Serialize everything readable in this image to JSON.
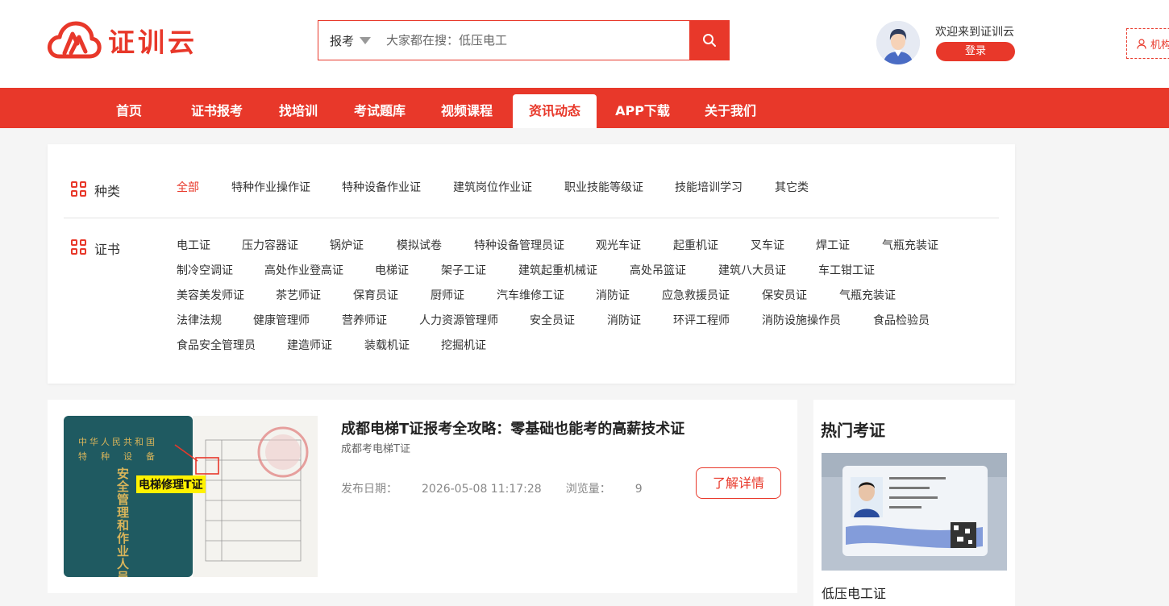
{
  "brand": {
    "name": "证训云",
    "accent": "#e8382a"
  },
  "search": {
    "category": "报考",
    "placeholder": "大家都在搜：低压电工"
  },
  "user": {
    "welcome": "欢迎来到证训云",
    "login_label": "登录",
    "org_label": "机构"
  },
  "nav": {
    "items": [
      {
        "label": "首页"
      },
      {
        "label": "证书报考"
      },
      {
        "label": "找培训"
      },
      {
        "label": "考试题库"
      },
      {
        "label": "视频课程"
      },
      {
        "label": "资讯动态"
      },
      {
        "label": "APP下载"
      },
      {
        "label": "关于我们"
      }
    ],
    "active": "资讯动态"
  },
  "filter": {
    "category_title": "种类",
    "categories": [
      "全部",
      "特种作业操作证",
      "特种设备作业证",
      "建筑岗位作业证",
      "职业技能等级证",
      "技能培训学习",
      "其它类"
    ],
    "active_category": "全部",
    "cert_title": "证书",
    "certificates": [
      [
        "电工证",
        "压力容器证",
        "锅炉证",
        "模拟试卷",
        "特种设备管理员证",
        "观光车证",
        "起重机证",
        "叉车证",
        "焊工证",
        "气瓶充装证"
      ],
      [
        "制冷空调证",
        "高处作业登高证",
        "电梯证",
        "架子工证",
        "建筑起重机械证",
        "高处吊篮证",
        "建筑八大员证",
        "车工钳工证"
      ],
      [
        "美容美发师证",
        "茶艺师证",
        "保育员证",
        "厨师证",
        "汽车维修工证",
        "消防证",
        "应急救援员证",
        "保安员证",
        "气瓶充装证"
      ],
      [
        "法律法规",
        "健康管理师",
        "营养师证",
        "人力资源管理师",
        "安全员证",
        "消防证",
        "环评工程师",
        "消防设施操作员",
        "食品检验员"
      ],
      [
        "食品安全管理员",
        "建造师证",
        "装载机证",
        "挖掘机证"
      ]
    ]
  },
  "article": {
    "title": "成都电梯T证报考全攻略：零基础也能考的高薪技术证",
    "subtitle": "成都考电梯T证",
    "date_label": "发布日期：",
    "date": "2026-05-08 11:17:28",
    "views_label": "浏览量：",
    "views": "9",
    "detail_label": "了解详情",
    "thumb": {
      "cover_lines": [
        "中华人民共和国",
        "特　种　设　备"
      ],
      "cover_vertical": "安全管理和作业人员证",
      "callout": "电梯修理T证"
    }
  },
  "hot": {
    "title": "热门考证",
    "items": [
      {
        "label": "低压电工证"
      }
    ]
  }
}
